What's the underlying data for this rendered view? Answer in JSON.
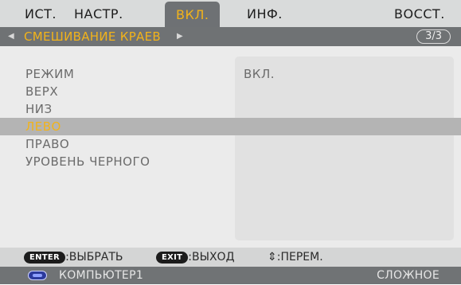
{
  "tabs": [
    {
      "label": "ИСТ."
    },
    {
      "label": "НАСТР."
    },
    {
      "label": "ВКЛ."
    },
    {
      "label": "ИНФ."
    },
    {
      "label": "ВОССТ."
    }
  ],
  "active_tab": "ВКЛ.",
  "titlebar": {
    "left_arrow": "◀",
    "title": "СМЕШИВАНИЕ КРАЕВ",
    "right_arrow": "▶",
    "page": "3/3"
  },
  "menu": {
    "items": [
      {
        "label": "РЕЖИМ",
        "value": "ВКЛ."
      },
      {
        "label": "ВЕРХ",
        "value": ""
      },
      {
        "label": "НИЗ",
        "value": ""
      },
      {
        "label": "ЛЕВО",
        "value": ""
      },
      {
        "label": "ПРАВО",
        "value": ""
      },
      {
        "label": "УРОВЕНЬ ЧЕРНОГО",
        "value": ""
      }
    ],
    "selected": "ЛЕВО"
  },
  "hints": {
    "enter_key": "ENTER",
    "enter_text": ":ВЫБРАТЬ",
    "exit_key": "EXIT",
    "exit_text": ":ВЫХОД",
    "move_text": "⇕:ПЕРЕМ."
  },
  "status": {
    "source": "КОМПЬЮТЕР1",
    "mode": "СЛОЖНОЕ"
  },
  "colors": {
    "accent": "#f2b31a",
    "tab_bar": "#d9dbdb",
    "header": "#6f7274",
    "panel": "#ebebeb",
    "selection": "#b4b4b4"
  }
}
